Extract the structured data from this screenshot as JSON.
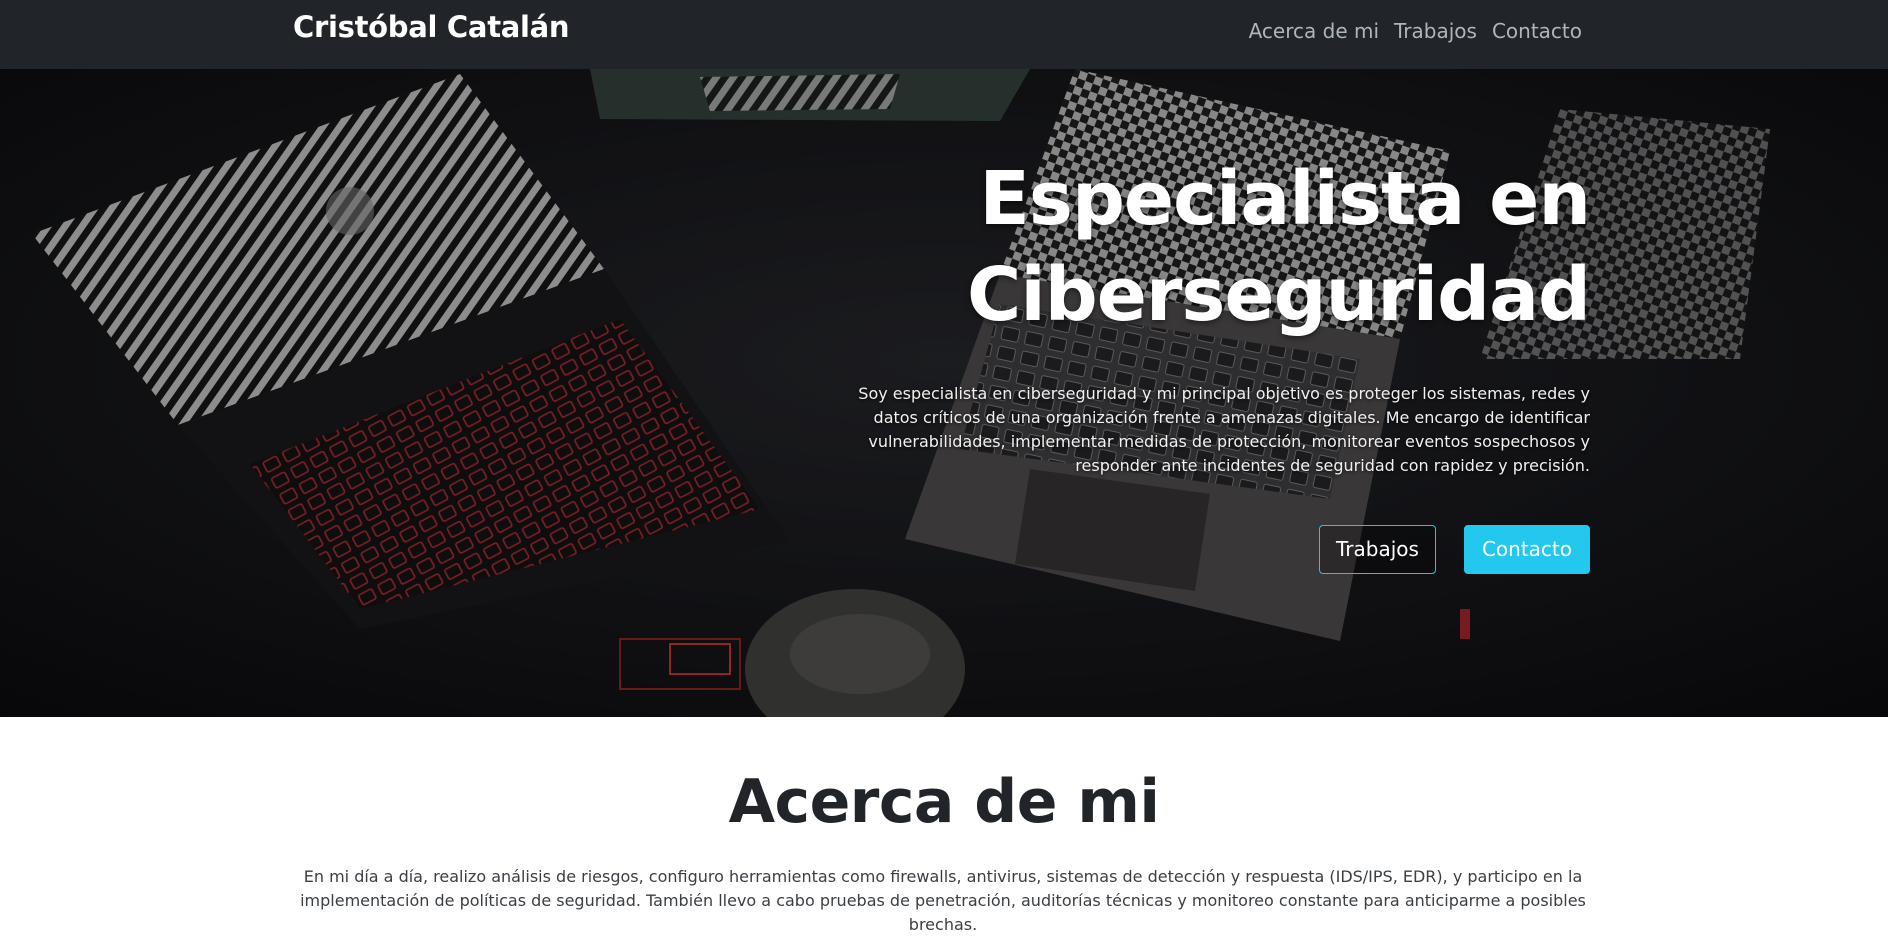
{
  "navbar": {
    "brand": "Cristóbal Catalán",
    "links": [
      "Acerca de mi",
      "Trabajos",
      "Contacto"
    ]
  },
  "hero": {
    "title": "Especialista en Ciberseguridad",
    "description": "Soy especialista en ciberseguridad y mi principal objetivo es proteger los sistemas, redes y datos críticos de una organización frente a amenazas digitales. Me encargo de identificar vulnerabilidades, implementar medidas de protección, monitorear eventos sospechosos y responder ante incidentes de seguridad con rapidez y precisión.",
    "buttons": {
      "works": "Trabajos",
      "contact": "Contacto"
    }
  },
  "about": {
    "title": "Acerca de mi",
    "text": "En mi día a día, realizo análisis de riesgos, configuro herramientas como firewalls, antivirus, sistemas de detección y respuesta (IDS/IPS, EDR), y participo en la implementación de políticas de seguridad. También llevo a cabo pruebas de penetración, auditorías técnicas y monitoreo constante para anticiparme a posibles brechas."
  },
  "colors": {
    "navbar_bg": "#212529",
    "accent": "#22c8ee",
    "nav_link": "#adb5bd"
  }
}
